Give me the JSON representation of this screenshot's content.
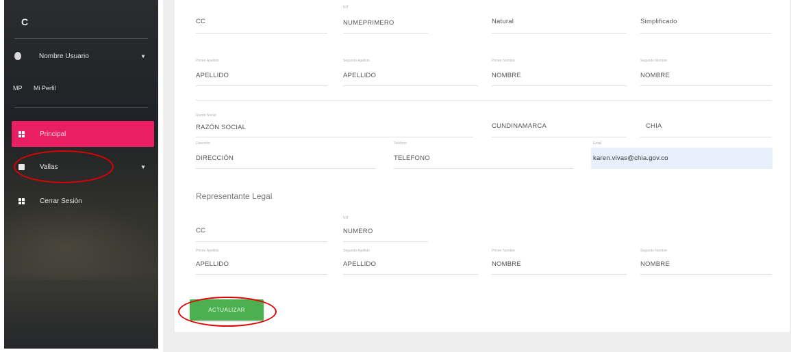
{
  "sidebar": {
    "logo": "C",
    "user_name": "Nombre Usuario",
    "profile_abbr": "MP",
    "profile_label": "Mi Perfil",
    "items": [
      {
        "label": "Principal",
        "icon": "dashboard-icon"
      },
      {
        "label": "Vallas",
        "icon": "image-icon"
      },
      {
        "label": "Cerrar Sesión",
        "icon": "dashboard-icon"
      }
    ],
    "active_color": "#e91e63"
  },
  "form": {
    "row1": {
      "doc_type": "CC",
      "nit_label": "NIT",
      "nit_value": "NUMEPRIMERO",
      "person_type": "Natural",
      "regime": "Simplificado"
    },
    "row2": {
      "first_surname_label": "Primer Apellido",
      "first_surname": "APELLIDO",
      "second_surname_label": "Segundo Apellido",
      "second_surname": "APELLIDO",
      "first_name_label": "Primer Nombre",
      "first_name": "NOMBRE",
      "second_name_label": "Segundo Nombre",
      "second_name": "NOMBRE"
    },
    "row3": {
      "company_label": "Razón Social",
      "company": "RAZÓN SOCIAL",
      "department": "CUNDINAMARCA",
      "city": "CHIA"
    },
    "row4": {
      "address_label": "Dirección",
      "address": "DIRECCIÓN",
      "phone_label": "Teléfono",
      "phone": "TELEFONO",
      "email_label": "Email",
      "email": "karen.vivas@chia.gov.co"
    },
    "legal_rep": {
      "title": "Representante Legal",
      "doc_type": "CC",
      "nit_label": "NIT",
      "nit_value": "NUMERO",
      "first_surname_label": "Primer Apellido",
      "first_surname": "APELLIDO",
      "second_surname_label": "Segundo Apellido",
      "second_surname": "APELLIDO",
      "first_name_label": "Primer Nombre",
      "first_name": "NOMBRE",
      "second_name_label": "Segundo Nombre",
      "second_name": "NOMBRE"
    },
    "update_button": "ACTUALIZAR",
    "button_color": "#4caf50",
    "highlight_color": "#e00000"
  }
}
